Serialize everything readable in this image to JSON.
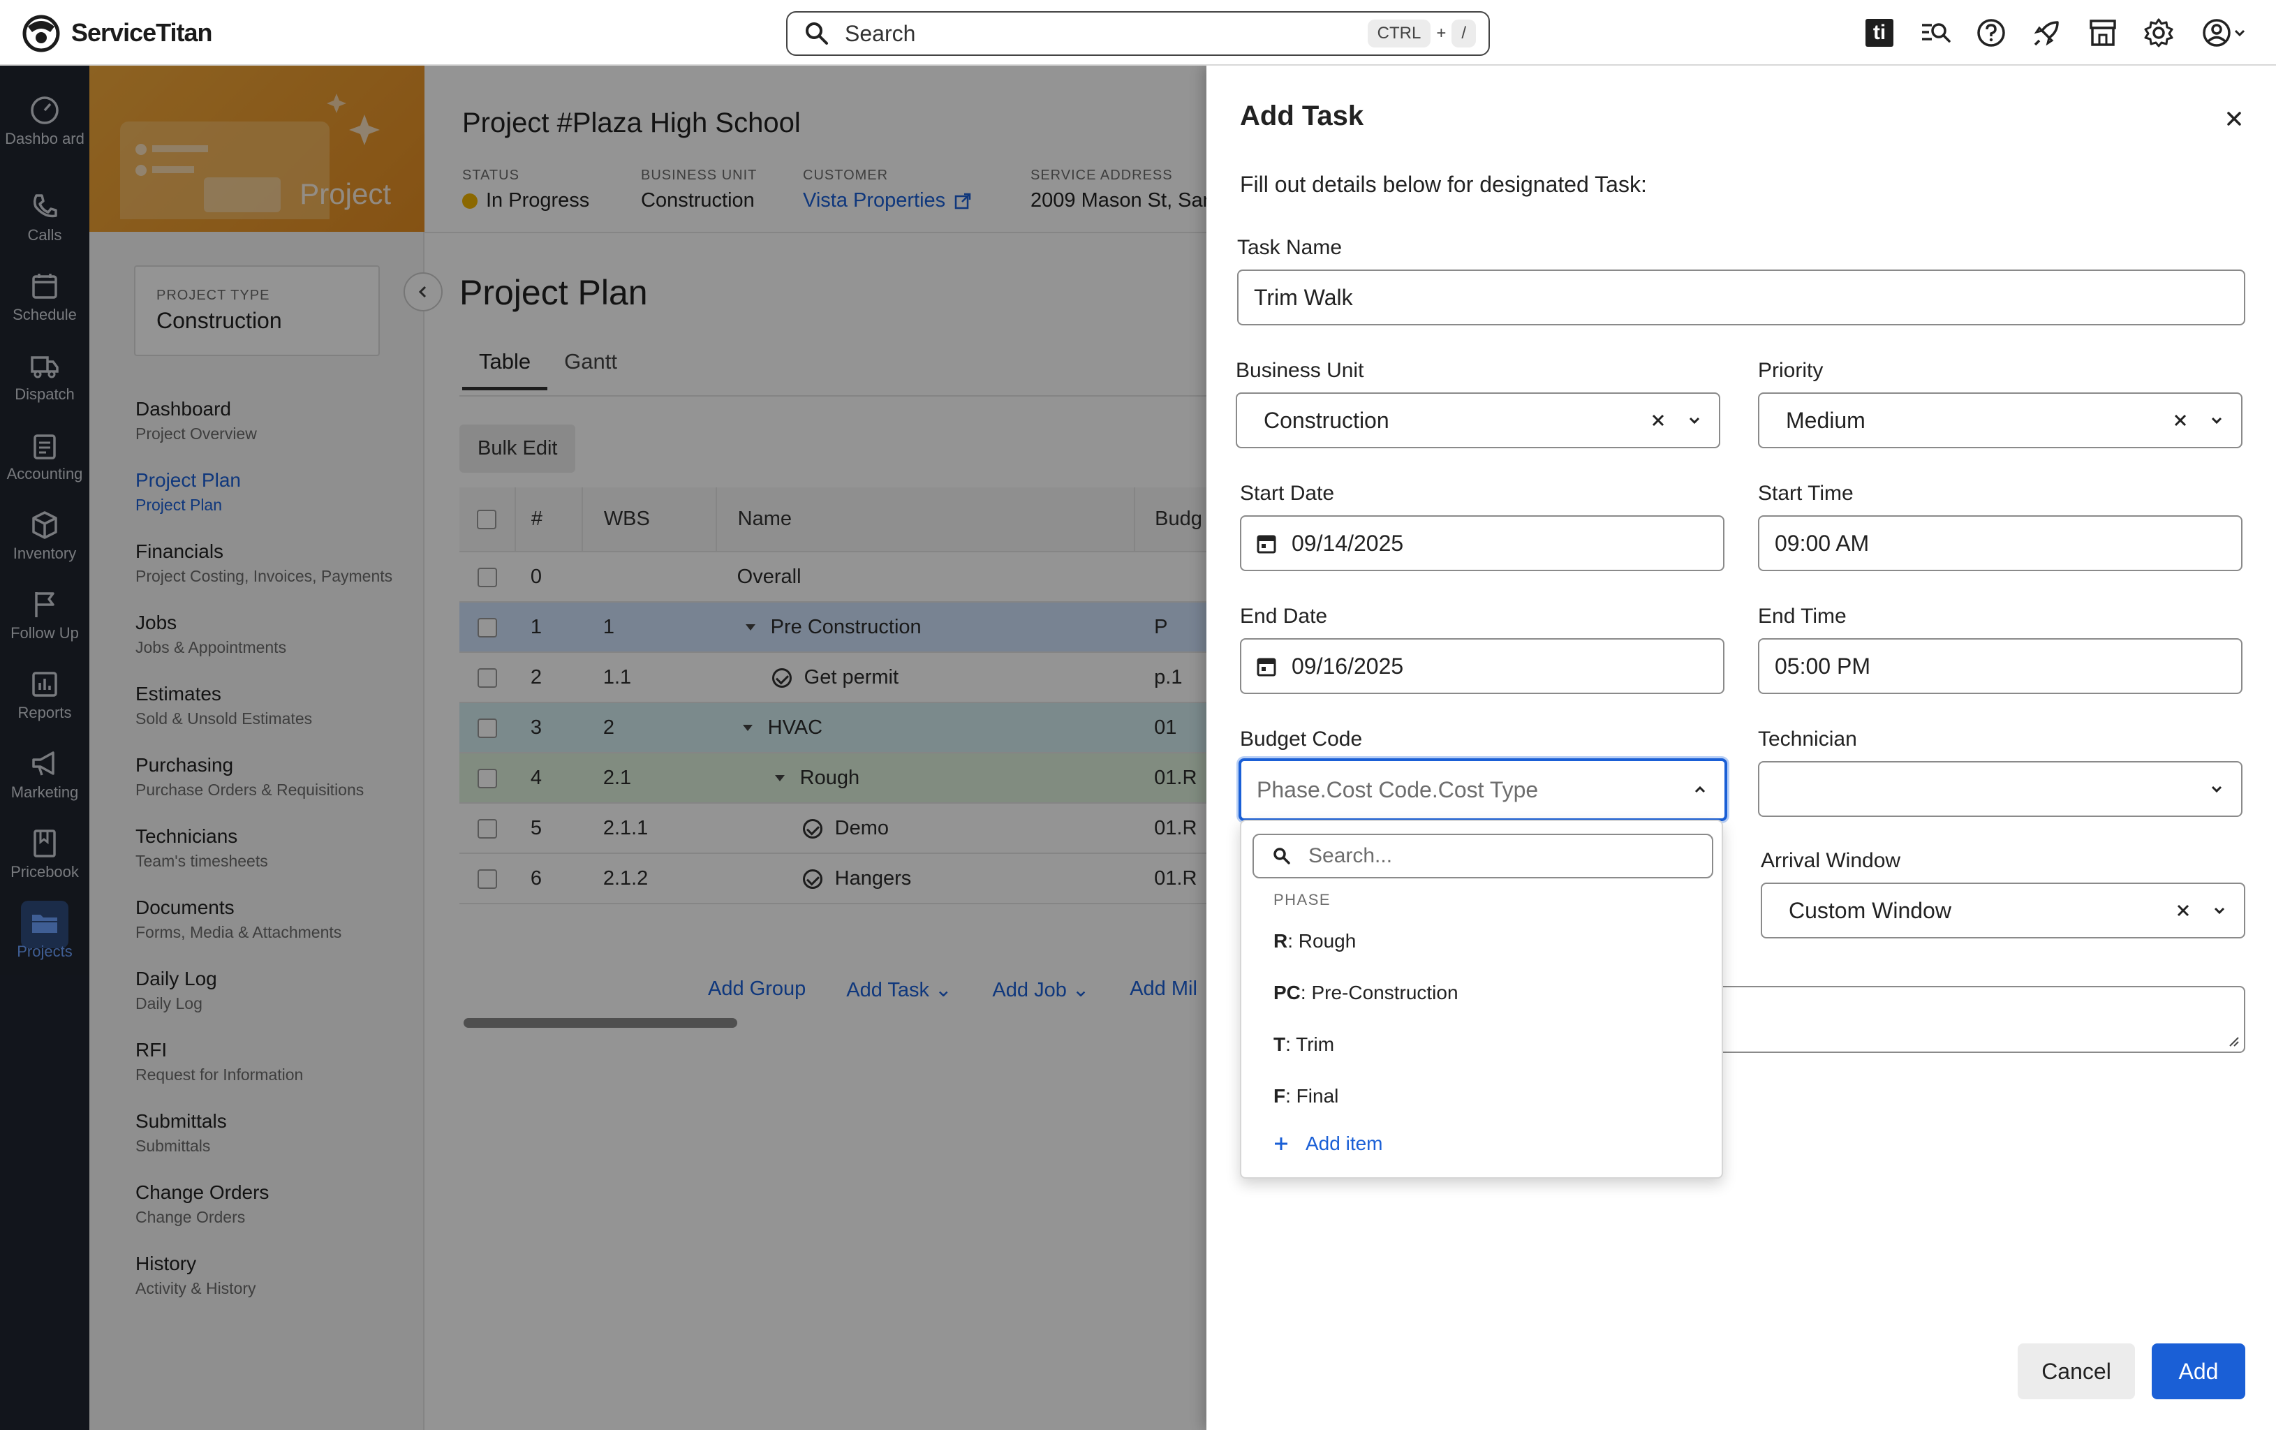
{
  "brand": {
    "name": "ServiceTitan"
  },
  "search": {
    "placeholder": "Search",
    "shortcut_key1": "CTRL",
    "shortcut_plus": "+",
    "shortcut_key2": "/"
  },
  "top_icons": [
    "titan-intelligence-icon",
    "search-list-icon",
    "help-icon",
    "rocket-icon",
    "store-icon",
    "gear-icon",
    "account-icon"
  ],
  "top_ti_label": "ti",
  "rail": [
    {
      "label": "Dashbo ard",
      "icon": "dashboard-icon"
    },
    {
      "label": "Calls",
      "icon": "phone-icon"
    },
    {
      "label": "Schedule",
      "icon": "calendar-icon"
    },
    {
      "label": "Dispatch",
      "icon": "truck-icon"
    },
    {
      "label": "Accounting",
      "icon": "clipboard-icon"
    },
    {
      "label": "Inventory",
      "icon": "box-icon"
    },
    {
      "label": "Follow Up",
      "icon": "flag-icon"
    },
    {
      "label": "Reports",
      "icon": "chart-icon"
    },
    {
      "label": "Marketing",
      "icon": "megaphone-icon"
    },
    {
      "label": "Pricebook",
      "icon": "book-icon"
    },
    {
      "label": "Projects",
      "icon": "folder-icon"
    }
  ],
  "project": {
    "banner_label": "Project",
    "type_label": "PROJECT TYPE",
    "type_value": "Construction",
    "title": "Project #Plaza High School",
    "meta": [
      {
        "label": "STATUS",
        "value": "In Progress"
      },
      {
        "label": "BUSINESS UNIT",
        "value": "Construction"
      },
      {
        "label": "CUSTOMER",
        "value": "Vista Properties"
      },
      {
        "label": "SERVICE ADDRESS",
        "value": "2009 Mason St, San"
      }
    ]
  },
  "nav": [
    {
      "title": "Dashboard",
      "sub": "Project Overview"
    },
    {
      "title": "Project Plan",
      "sub": "Project Plan"
    },
    {
      "title": "Financials",
      "sub": "Project Costing, Invoices, Payments"
    },
    {
      "title": "Jobs",
      "sub": "Jobs & Appointments"
    },
    {
      "title": "Estimates",
      "sub": "Sold & Unsold Estimates"
    },
    {
      "title": "Purchasing",
      "sub": "Purchase Orders & Requisitions"
    },
    {
      "title": "Technicians",
      "sub": "Team's timesheets"
    },
    {
      "title": "Documents",
      "sub": "Forms, Media & Attachments"
    },
    {
      "title": "Daily Log",
      "sub": "Daily Log"
    },
    {
      "title": "RFI",
      "sub": "Request for Information"
    },
    {
      "title": "Submittals",
      "sub": "Submittals"
    },
    {
      "title": "Change Orders",
      "sub": "Change Orders"
    },
    {
      "title": "History",
      "sub": "Activity & History"
    }
  ],
  "plan": {
    "title": "Project Plan",
    "tabs": [
      "Table",
      "Gantt"
    ],
    "bulk_edit": "Bulk Edit",
    "columns": [
      "#",
      "WBS",
      "Name",
      "Budg Code"
    ],
    "rows": [
      {
        "num": "0",
        "wbs": "",
        "name": "Overall",
        "code": ""
      },
      {
        "num": "1",
        "wbs": "1",
        "name": "Pre Construction",
        "code": "P"
      },
      {
        "num": "2",
        "wbs": "1.1",
        "name": "Get permit",
        "code": "p.1"
      },
      {
        "num": "3",
        "wbs": "2",
        "name": "HVAC",
        "code": "01"
      },
      {
        "num": "4",
        "wbs": "2.1",
        "name": "Rough",
        "code": "01.R"
      },
      {
        "num": "5",
        "wbs": "2.1.1",
        "name": "Demo",
        "code": "01.R"
      },
      {
        "num": "6",
        "wbs": "2.1.2",
        "name": "Hangers",
        "code": "01.R"
      }
    ],
    "add_actions": [
      "Add Group",
      "Add Task",
      "Add Job",
      "Add Mil"
    ]
  },
  "drawer": {
    "title": "Add Task",
    "subtitle": "Fill out details below for designated Task:",
    "task_name_label": "Task Name",
    "task_name_value": "Trim Walk",
    "business_unit_label": "Business Unit",
    "business_unit_value": "Construction",
    "priority_label": "Priority",
    "priority_value": "Medium",
    "start_date_label": "Start Date",
    "start_date_value": "09/14/2025",
    "start_time_label": "Start Time",
    "start_time_value": "09:00 AM",
    "end_date_label": "End Date",
    "end_date_value": "09/16/2025",
    "end_time_label": "End Time",
    "end_time_value": "05:00 PM",
    "budget_code_label": "Budget Code",
    "budget_code_placeholder": "Phase.Cost Code.Cost Type",
    "technician_label": "Technician",
    "technician_value": "",
    "arrival_window_label": "Arrival Window",
    "arrival_window_value": "Custom Window",
    "cancel_label": "Cancel",
    "add_label": "Add",
    "dropdown": {
      "search_placeholder": "Search...",
      "group_label": "PHASE",
      "items": [
        {
          "code": "R",
          "name": ": Rough"
        },
        {
          "code": "PC",
          "name": ": Pre-Construction"
        },
        {
          "code": "T",
          "name": ": Trim"
        },
        {
          "code": "F",
          "name": ": Final"
        }
      ],
      "add_item_label": "Add item"
    }
  },
  "colors": {
    "accent": "#1a5fd6",
    "rail_bg": "#1f2530",
    "banner": "#f2a93b",
    "status_dot": "#f0b400"
  }
}
